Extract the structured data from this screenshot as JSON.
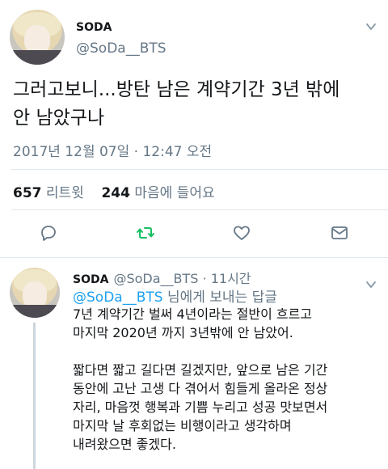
{
  "main_tweet": {
    "name": "SODA",
    "handle": "@SoDa__BTS",
    "text": "그러고보니...방탄 남은 계약기간 3년 밖에\n안 남았구나",
    "timestamp": "2017년 12월 07일 · 12:47 오전",
    "retweet_count": "657",
    "retweet_label": "리트윗",
    "like_count": "244",
    "like_label": "마음에 들어요",
    "icons": {
      "reply": "reply-icon",
      "retweet": "retweet-icon",
      "like": "heart-icon",
      "dm": "message-icon",
      "menu": "chevron-down-icon"
    },
    "colors": {
      "retweet_active": "#17bf63",
      "icon_gray": "#657786"
    }
  },
  "reply_tweet": {
    "name": "SODA",
    "handle": "@SoDa__BTS",
    "separator": "·",
    "time": "11시간",
    "reply_to_mention": "@SoDa__BTS",
    "reply_to_suffix": " 님에게 보내는 답글",
    "paragraphs": [
      "7년 계약기간 벌써 4년이라는 절반이 흐르고\n마지막 2020년 까지 3년밖에 안 남았어.",
      "짧다면 짧고 길다면 길겠지만, 앞으로 남은 기간\n동안에 고난 고생 다 겪어서 힘들게 올라온 정상\n자리, 마음껏 행복과 기쁨 누리고 성공 맛보면서\n마지막 날 후회없는 비행이라고 생각하며\n내려왔으면 좋겠다."
    ],
    "colors": {
      "mention": "#1da1f2"
    }
  }
}
